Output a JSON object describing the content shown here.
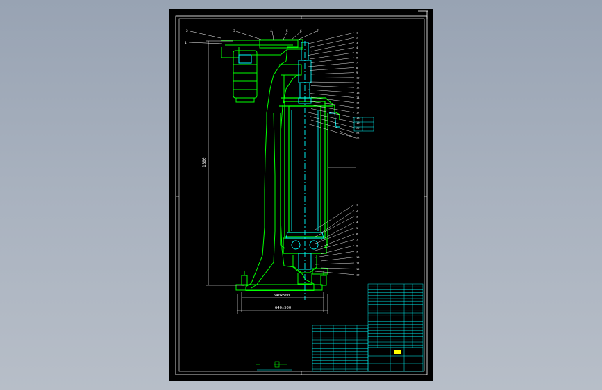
{
  "drawing": {
    "dimensions": {
      "height": "1800",
      "base_inner": "640×500",
      "base_outer": "640×500"
    },
    "balloons_top": [
      "2",
      "3",
      "4",
      "5",
      "6",
      "7"
    ],
    "balloon_left": "1",
    "balloons_right_upper": [
      "1",
      "2",
      "3",
      "4",
      "5",
      "6",
      "7",
      "8",
      "9",
      "10",
      "11",
      "12",
      "13",
      "14",
      "15",
      "16",
      "17",
      "18",
      "19",
      "20",
      "21",
      "22"
    ],
    "balloons_right_lower": [
      "1",
      "2",
      "3",
      "4",
      "5",
      "6",
      "7",
      "8",
      "9",
      "10",
      "11",
      "12",
      "13"
    ],
    "colors": {
      "sheet": "#000000",
      "frame": "#ffffff",
      "part_outline": "#00ff00",
      "detail": "#00ffff",
      "dimension": "#ffffff"
    }
  }
}
